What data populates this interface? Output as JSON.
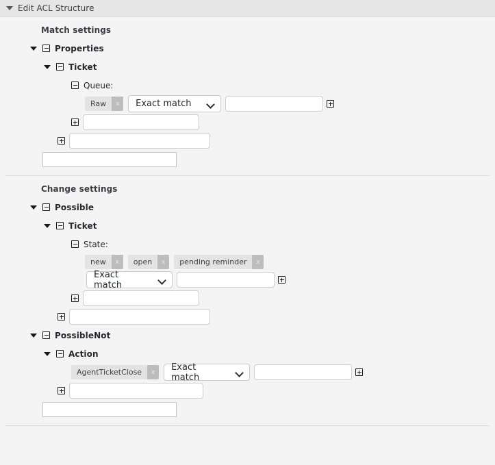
{
  "header": {
    "title": "Edit ACL Structure",
    "caret_icon": "caret-down-icon"
  },
  "match_section": {
    "title": "Match settings",
    "groups": [
      {
        "label": "Properties",
        "children": [
          {
            "label": "Ticket",
            "attributes": [
              {
                "label": "Queue:",
                "chips": [
                  {
                    "text": "Raw",
                    "remove": "x"
                  }
                ],
                "match_type": "Exact match",
                "value": "",
                "add_label": "+"
              }
            ],
            "new_attribute_placeholder": ""
          }
        ],
        "new_child_placeholder": ""
      }
    ],
    "new_group_placeholder": ""
  },
  "change_section": {
    "title": "Change settings",
    "groups": [
      {
        "label": "Possible",
        "children": [
          {
            "label": "Ticket",
            "attributes": [
              {
                "label": "State:",
                "chips": [
                  {
                    "text": "new",
                    "remove": "x"
                  },
                  {
                    "text": "open",
                    "remove": "x"
                  },
                  {
                    "text": "pending reminder",
                    "remove": "x"
                  }
                ],
                "match_type": "Exact match",
                "value": "",
                "add_label": "+"
              }
            ],
            "new_attribute_placeholder": ""
          }
        ],
        "new_child_placeholder": ""
      },
      {
        "label": "PossibleNot",
        "children": [
          {
            "label": "Action",
            "attributes": [
              {
                "label": "",
                "chips": [
                  {
                    "text": "AgentTicketClose",
                    "remove": "x"
                  }
                ],
                "match_type": "Exact match",
                "value": "",
                "add_label": "+"
              }
            ],
            "new_attribute_placeholder": ""
          }
        ]
      }
    ],
    "new_group_placeholder": ""
  },
  "colors": {
    "background": "#f4f4f4",
    "header_bar": "#e6e6e6",
    "chip_bg": "#e3e3e3",
    "chip_x_bg": "#bdbdbd",
    "input_border": "#c9c9c9",
    "separator": "#dcdcdc",
    "text": "#23282c"
  }
}
